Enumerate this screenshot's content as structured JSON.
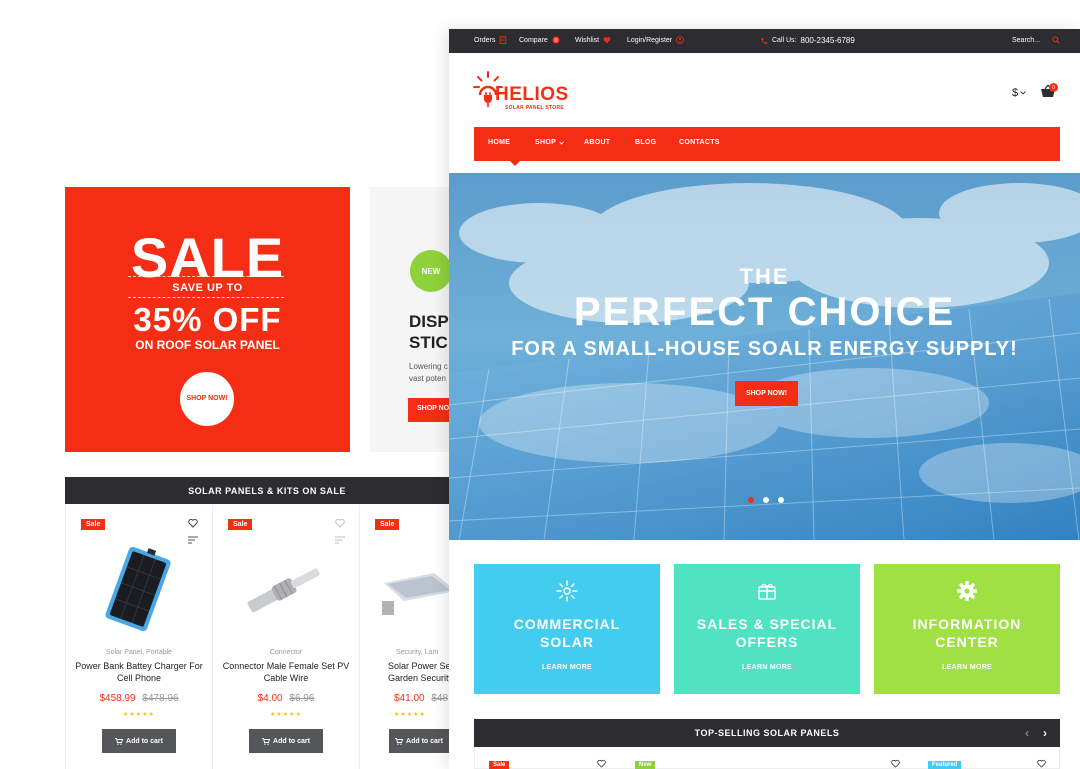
{
  "left": {
    "sale_banner": {
      "headline": "SALE",
      "save": "SAVE UP TO",
      "percent": "35% OFF",
      "product": "ON ROOF SOLAR PANEL",
      "button": "SHOP NOW!"
    },
    "promo": {
      "badge": "NEW",
      "title": "DISP\nSTIC",
      "text": "Lowering c\nvast poten",
      "button": "SHOP NO"
    },
    "section_title": "SOLAR PANELS & KITS ON SALE",
    "products": [
      {
        "badge": "Sale",
        "category": "Solar Panel, Portable",
        "name": "Power Bank Battey Charger For Cell Phone",
        "price": "$458.99",
        "old_price": "$478.96",
        "button": "Add to cart"
      },
      {
        "badge": "Sale",
        "category": "Connector",
        "name": "Connector Male Female Set PV Cable Wire",
        "price": "$4.00",
        "old_price": "$6.96",
        "button": "Add to cart"
      },
      {
        "badge": "Sale",
        "category": "Security, Lam",
        "name": "Solar Power Se Garden Security",
        "price": "$41.00",
        "old_price": "$48",
        "button": "Add to cart"
      }
    ],
    "stars": "★★★★★"
  },
  "front": {
    "topbar": {
      "orders": "Orders",
      "compare": "Compare",
      "wishlist": "Wishlist",
      "login": "Login/Register",
      "call_label": "Call Us:",
      "phone": "800-2345-6789",
      "search_placeholder": "Search..."
    },
    "logo": {
      "name": "HELIOS",
      "tagline": "SOLAR PANEL STORE"
    },
    "currency": "$",
    "cart_count": "0",
    "nav": [
      "HOME",
      "SHOP",
      "ABOUT",
      "BLOG",
      "CONTACTS"
    ],
    "hero": {
      "line1": "THE",
      "line2": "PERFECT CHOICE",
      "line3": "FOR A SMALL-HOUSE SOALR ENERGY SUPPLY!",
      "button": "SHOP NOW!",
      "slides": 3,
      "active_slide": 1
    },
    "features": [
      {
        "title": "COMMERCIAL\nSOLAR",
        "link": "LEARN MORE",
        "icon": "sun-icon",
        "color": "#42ccf0"
      },
      {
        "title": "SALES & SPECIAL\nOFFERS",
        "link": "LEARN MORE",
        "icon": "gift-icon",
        "color": "#4fe3c1"
      },
      {
        "title": "INFORMATION\nCENTER",
        "link": "LEARN MORE",
        "icon": "gear-icon",
        "color": "#9fe042"
      }
    ],
    "top_selling_title": "TOP-SELLING SOLAR PANELS",
    "mini_badges": [
      "Sale",
      "New",
      "Featured"
    ]
  },
  "colors": {
    "accent": "#f42d14",
    "dark": "#2c2c31",
    "green": "#8fd13b"
  }
}
